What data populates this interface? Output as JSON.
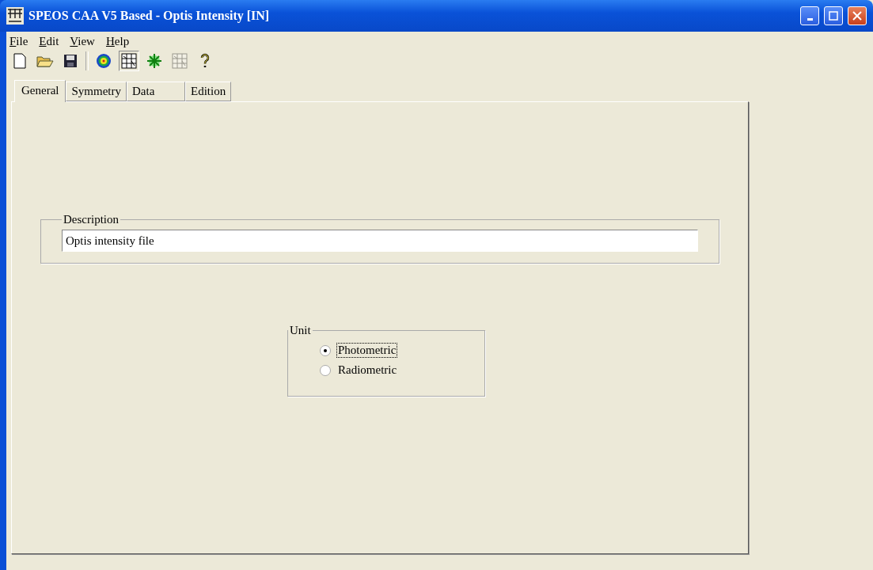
{
  "window": {
    "title": "SPEOS CAA V5 Based - Optis Intensity [IN]"
  },
  "menu": [
    {
      "label": "File"
    },
    {
      "label": "Edit"
    },
    {
      "label": "View"
    },
    {
      "label": "Help"
    }
  ],
  "toolbar": [
    {
      "kind": "new",
      "disabled": false,
      "pressed": false
    },
    {
      "kind": "open",
      "disabled": false,
      "pressed": false
    },
    {
      "kind": "save",
      "disabled": false,
      "pressed": false
    },
    {
      "kind": "separator"
    },
    {
      "kind": "target",
      "disabled": false,
      "pressed": false
    },
    {
      "kind": "grid",
      "disabled": false,
      "pressed": true
    },
    {
      "kind": "star",
      "disabled": false,
      "pressed": false
    },
    {
      "kind": "grid",
      "disabled": true,
      "pressed": false
    },
    {
      "kind": "help",
      "disabled": false,
      "pressed": false
    }
  ],
  "tabs": [
    {
      "label": "General",
      "selected": true
    },
    {
      "label": "Symmetry",
      "selected": false
    },
    {
      "label": "Data",
      "selected": false
    },
    {
      "label": "Edition",
      "selected": false
    }
  ],
  "description": {
    "legend": "Description",
    "value": "Optis intensity file"
  },
  "unit": {
    "legend": "Unit",
    "options": [
      {
        "label": "Photometric",
        "selected": true
      },
      {
        "label": "Radiometric",
        "selected": false
      }
    ]
  }
}
